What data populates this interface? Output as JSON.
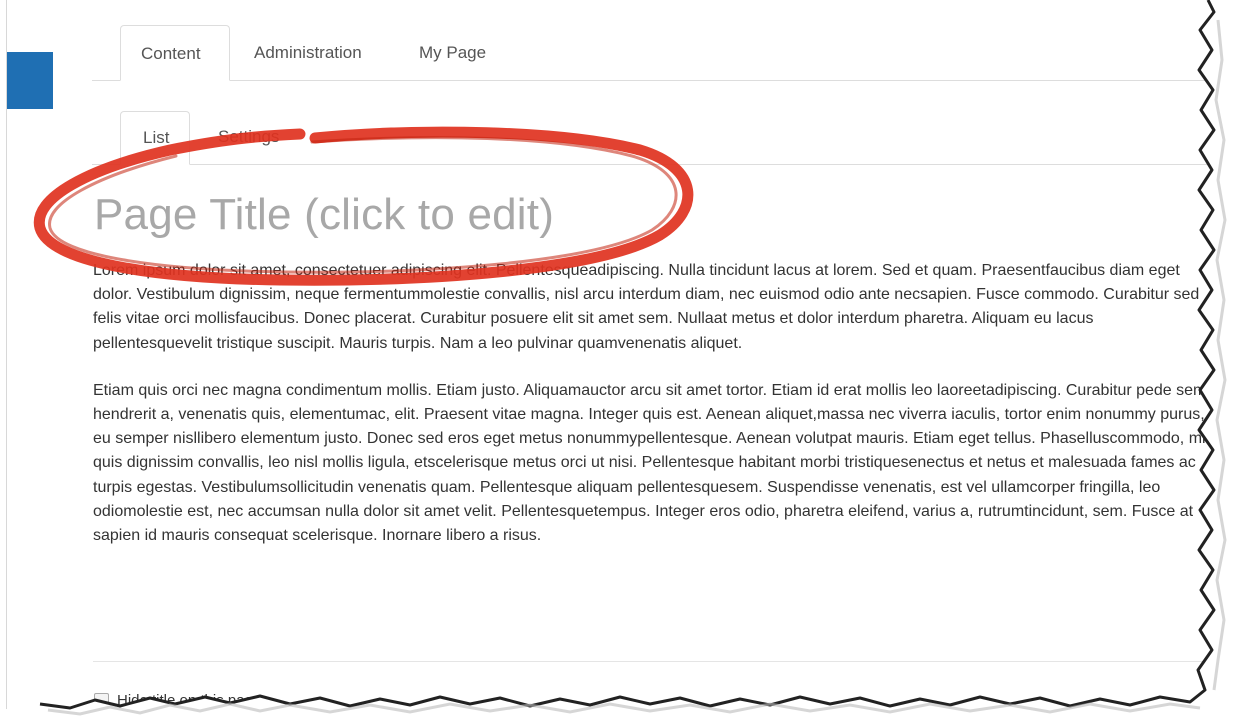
{
  "tabs": {
    "primary": [
      {
        "label": "Content",
        "active": true
      },
      {
        "label": "Administration",
        "active": false
      },
      {
        "label": "My Page",
        "active": false
      }
    ],
    "secondary": [
      {
        "label": "List",
        "active": true
      },
      {
        "label": "Settings",
        "active": false
      }
    ]
  },
  "page": {
    "title": "Page Title (click to edit)",
    "paragraphs": [
      "Lorem ipsum dolor sit amet, consectetuer adipiscing elit. Pellentesqueadipiscing. Nulla tincidunt lacus at lorem. Sed et quam. Praesentfaucibus diam eget dolor. Vestibulum dignissim, neque fermentummolestie convallis, nisl arcu interdum diam, nec euismod odio ante necsapien. Fusce commodo. Curabitur sed felis vitae orci mollisfaucibus. Donec placerat. Curabitur posuere elit sit amet sem. Nullaat metus et dolor interdum pharetra. Aliquam eu lacus pellentesquevelit tristique suscipit. Mauris turpis. Nam a leo pulvinar quamvenenatis aliquet.",
      "Etiam quis orci nec magna condimentum mollis. Etiam justo. Aliquamauctor arcu sit amet tortor. Etiam id erat mollis leo laoreetadipiscing. Curabitur pede sem, hendrerit a, venenatis quis, elementumac, elit. Praesent vitae magna. Integer quis est. Aenean aliquet,massa nec viverra iaculis, tortor enim nonummy purus, eu semper nisllibero elementum justo. Donec sed eros eget metus nonummypellentesque. Aenean volutpat mauris. Etiam eget tellus. Phaselluscommodo, mi quis dignissim convallis, leo nisl mollis ligula, etscelerisque metus orci ut nisi. Pellentesque habitant morbi tristiquesenectus et netus et malesuada fames ac turpis egestas. Vestibulumsollicitudin venenatis quam. Pellentesque aliquam pellentesquesem. Suspendisse venenatis, est vel ullamcorper fringilla, leo odiomolestie est, nec accumsan nulla dolor sit amet velit. Pellentesquetempus. Integer eros odio, pharetra eleifend, varius a, rutrumtincidunt, sem. Fusce at sapien id mauris consequat scelerisque. Inornare libero a risus."
    ],
    "checkbox_label": "Hide title on this page"
  },
  "colors": {
    "accent_blue": "#1f6fb3",
    "annotation_red": "#e0321f",
    "title_gray": "#a8a8a8"
  }
}
